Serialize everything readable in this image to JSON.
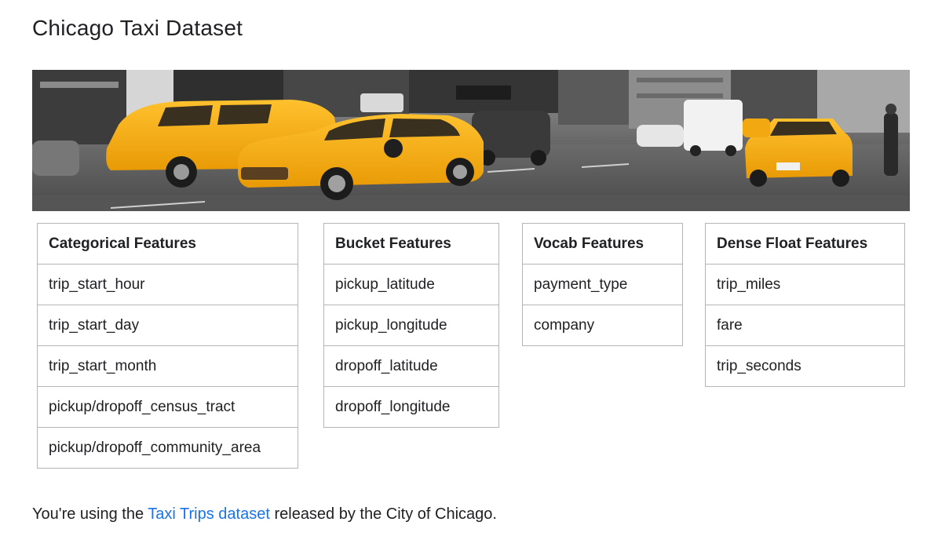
{
  "page": {
    "title": "Chicago Taxi Dataset"
  },
  "hero": {
    "image_name": "chicago-taxi-street-photo",
    "taxi_color": "#f5a80f"
  },
  "tables": {
    "categorical": {
      "header": "Categorical Features",
      "rows": [
        "trip_start_hour",
        "trip_start_day",
        "trip_start_month",
        "pickup/dropoff_census_tract",
        "pickup/dropoff_community_area"
      ]
    },
    "bucket": {
      "header": "Bucket Features",
      "rows": [
        "pickup_latitude",
        "pickup_longitude",
        "dropoff_latitude",
        "dropoff_longitude"
      ]
    },
    "vocab": {
      "header": "Vocab Features",
      "rows": [
        "payment_type",
        "company"
      ]
    },
    "dense": {
      "header": "Dense Float Features",
      "rows": [
        "trip_miles",
        "fare",
        "trip_seconds"
      ]
    }
  },
  "footer": {
    "prefix": "You're using the ",
    "link_text": "Taxi Trips dataset",
    "suffix": " released by the City of Chicago."
  },
  "colors": {
    "link": "#1a73e8",
    "border": "#b5b5b5",
    "text": "#202124"
  }
}
